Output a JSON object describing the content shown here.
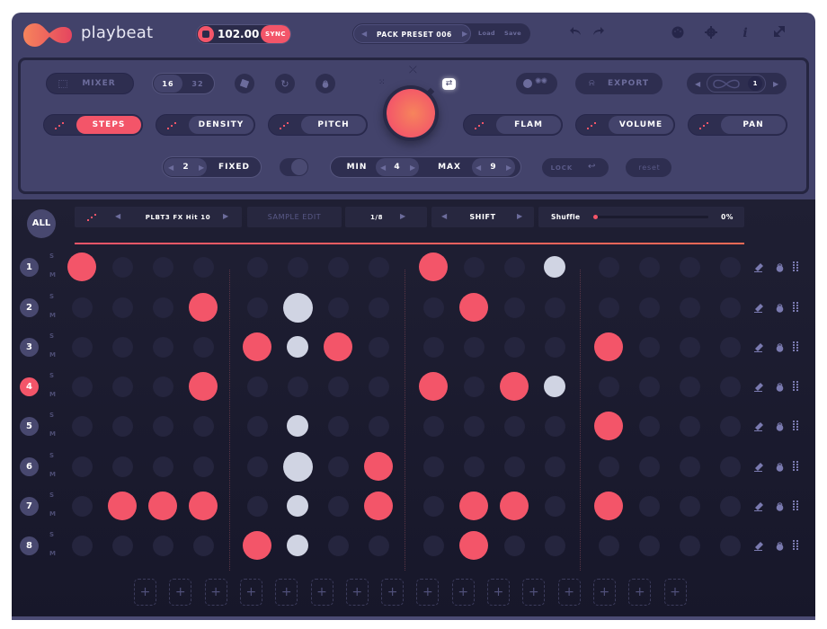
{
  "header": {
    "app_name": "playbeat",
    "tempo": "102.00",
    "sync_label": "SYNC",
    "preset_name": "PACK PRESET 006",
    "load_label": "Load",
    "save_label": "Save",
    "icons": [
      "undo-icon",
      "redo-icon",
      "midi-icon",
      "gear-icon",
      "info-icon",
      "expand-icon"
    ]
  },
  "controls": {
    "mixer_label": "MIXER",
    "steps_options": [
      "16",
      "32"
    ],
    "steps_selected": "16",
    "modes": [
      {
        "label": "STEPS",
        "active": true
      },
      {
        "label": "DENSITY",
        "active": false
      },
      {
        "label": "PITCH",
        "active": false
      },
      {
        "label": "FLAM",
        "active": false
      },
      {
        "label": "VOLUME",
        "active": false
      },
      {
        "label": "PAN",
        "active": false
      }
    ],
    "export_label": "EXPORT",
    "loop_count": "1",
    "fixed_value": "2",
    "fixed_label": "FIXED",
    "min_label": "MIN",
    "min_value": "4",
    "max_label": "MAX",
    "max_value": "9",
    "lock_label": "LOCK",
    "reset_label": "reset"
  },
  "sequencer": {
    "all_label": "ALL",
    "sample_name": "PLBT3 FX Hit 10",
    "sample_edit_label": "SAMPLE EDIT",
    "rate": "1/8",
    "shift_label": "SHIFT",
    "shuffle_label": "Shuffle",
    "shuffle_value": "0%",
    "solo_label": "S",
    "mute_label": "M",
    "selected_row": 4,
    "rows": [
      {
        "number": "1",
        "steps": [
          "R",
          "-",
          "-",
          "-",
          "-",
          "-",
          "-",
          "-",
          "R",
          "-",
          "-",
          "w",
          "-",
          "-",
          "-",
          "-"
        ]
      },
      {
        "number": "2",
        "steps": [
          "-",
          "-",
          "-",
          "R",
          "-",
          "W",
          "-",
          "-",
          "-",
          "R",
          "-",
          "-",
          "-",
          "-",
          "-",
          "-"
        ]
      },
      {
        "number": "3",
        "steps": [
          "-",
          "-",
          "-",
          "-",
          "R",
          "w",
          "R",
          "-",
          "-",
          "-",
          "-",
          "-",
          "R",
          "-",
          "-",
          "-"
        ]
      },
      {
        "number": "4",
        "steps": [
          "-",
          "-",
          "-",
          "R",
          "-",
          "-",
          "-",
          "-",
          "R",
          "-",
          "R",
          "w",
          "-",
          "-",
          "-",
          "-"
        ]
      },
      {
        "number": "5",
        "steps": [
          "-",
          "-",
          "-",
          "-",
          "-",
          "w",
          "-",
          "-",
          "-",
          "-",
          "-",
          "-",
          "R",
          "-",
          "-",
          "-"
        ]
      },
      {
        "number": "6",
        "steps": [
          "-",
          "-",
          "-",
          "-",
          "-",
          "W",
          "-",
          "R",
          "-",
          "-",
          "-",
          "-",
          "-",
          "-",
          "-",
          "-"
        ]
      },
      {
        "number": "7",
        "steps": [
          "-",
          "R",
          "R",
          "R",
          "-",
          "w",
          "-",
          "R",
          "-",
          "R",
          "R",
          "-",
          "R",
          "-",
          "-",
          "-"
        ]
      },
      {
        "number": "8",
        "steps": [
          "-",
          "-",
          "-",
          "-",
          "R",
          "w",
          "-",
          "-",
          "-",
          "R",
          "-",
          "-",
          "-",
          "-",
          "-",
          "-"
        ]
      }
    ],
    "add_slot_label": "+",
    "add_slots": 16
  },
  "colors": {
    "accent": "#f35569",
    "accent_light": "#d0d4e3",
    "panel": "#42426a",
    "background": "#1c1c30"
  }
}
